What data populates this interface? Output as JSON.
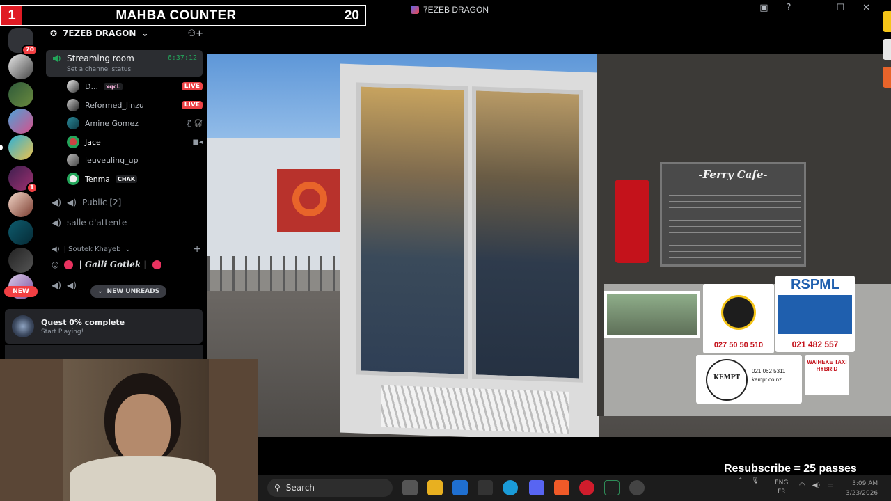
{
  "counter": {
    "number": "1",
    "title": "MAHBA COUNTER",
    "value": "20"
  },
  "window": {
    "title": "7EZEB DRAGON"
  },
  "rail": {
    "badge_top": "70",
    "badge_mid": "1",
    "new_label": "NEW"
  },
  "server": {
    "name": "7EZEB DRAGON"
  },
  "voice_room": {
    "name": "Streaming room",
    "status": "Set a channel status",
    "timer": "6:37:12"
  },
  "users": [
    {
      "name": "D...",
      "tag": "xqcL",
      "badge": "LIVE"
    },
    {
      "name": "Reformed_Jinzu",
      "badge": "LIVE"
    },
    {
      "name": "Amine Gomez"
    },
    {
      "name": "Jace"
    },
    {
      "name": "leuveuling_up"
    },
    {
      "name": "Tenma",
      "tag": "CHAK"
    }
  ],
  "channels": {
    "public": "Public [2]",
    "waiting": "salle d'attente",
    "category": "| Soutek Khayeb",
    "galli": "| Galli Gotlek |",
    "new_unreads": "NEW UNREADS"
  },
  "quest": {
    "title": "Quest 0% complete",
    "subtitle": "Start Playing!"
  },
  "stream": {
    "cafe_sign": "-Ferry Cafe-",
    "taxi_phone": "027 50 50 510",
    "rspml": "RSPML",
    "rspml_phone": "021 482 557",
    "kempt": "KEMPT",
    "kempt_info": "021 062 5311",
    "kempt_site": "kempt.co.nz",
    "waiheke": "WAIHEKE TAXI HYBRID",
    "overlay": "Resubscribe = 25 passes"
  },
  "taskbar": {
    "search": "Search",
    "lang_top": "ENG",
    "lang_bottom": "FR",
    "time": "3:09 AM",
    "date": "3/23/2026"
  },
  "colors": {
    "live": "#ed4245",
    "accent": "#5865f2",
    "online": "#23a55a",
    "counter_red": "#e01b24"
  }
}
